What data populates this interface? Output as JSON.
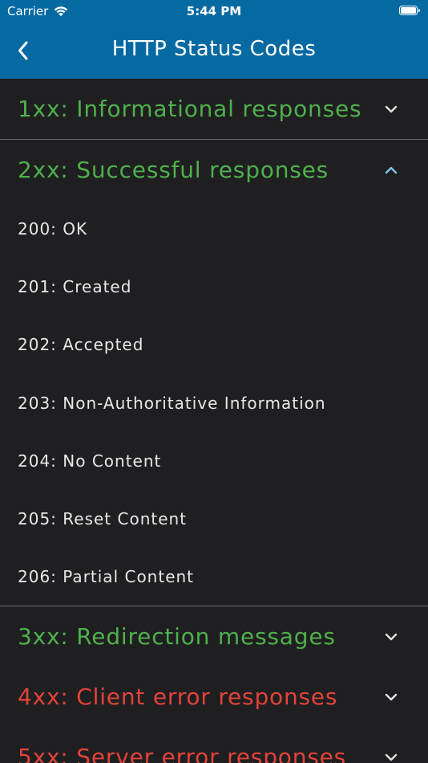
{
  "status_bar": {
    "carrier": "Carrier",
    "time": "5:44 PM",
    "icons": [
      "wifi-icon",
      "battery-icon"
    ]
  },
  "nav": {
    "title": "HTTP Status Codes",
    "back_icon": "chevron-left-icon"
  },
  "colors": {
    "header_bg": "#066aa2",
    "page_bg": "#1f1f21",
    "success_green": "#4fb04c",
    "error_red": "#e2433a",
    "chevron_collapsed": "#e0e0e0",
    "chevron_expanded": "#7ec3f0"
  },
  "sections": [
    {
      "title": "1xx: Informational responses",
      "expanded": false,
      "color": "#4fb04c"
    },
    {
      "title": "2xx: Successful responses",
      "expanded": true,
      "color": "#4fb04c",
      "items": [
        "200: OK",
        "201: Created",
        "202: Accepted",
        "203: Non-Authoritative Information",
        "204: No Content",
        "205: Reset Content",
        "206: Partial Content"
      ]
    },
    {
      "title": "3xx: Redirection messages",
      "expanded": false,
      "color": "#4fb04c"
    },
    {
      "title": "4xx: Client error responses",
      "expanded": false,
      "color": "#e2433a"
    },
    {
      "title": "5xx: Server error responses",
      "expanded": false,
      "color": "#e2433a"
    }
  ]
}
